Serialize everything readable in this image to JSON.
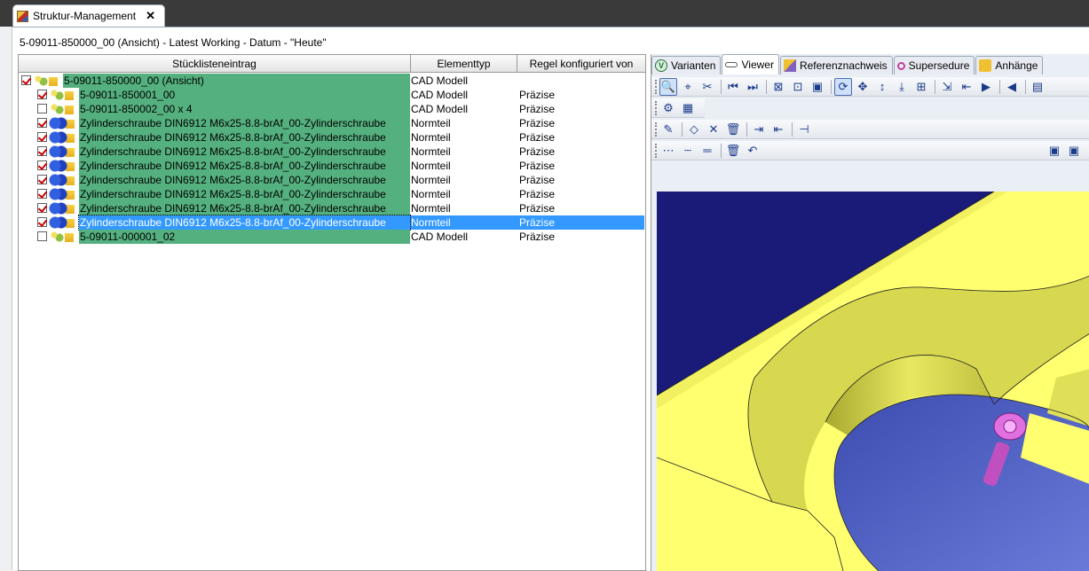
{
  "window": {
    "tab_title": "Struktur-Management",
    "close": "✕"
  },
  "headline": "5-09011-850000_00 (Ansicht) - Latest Working - Datum - \"Heute\"",
  "table": {
    "columns": [
      "Stücklisteneintrag",
      "Elementtyp",
      "Regel konfiguriert von"
    ],
    "rows": [
      {
        "name": "5-09011-850000_00 (Ansicht)",
        "type": "CAD Modell",
        "rule": "",
        "checked": true,
        "icon": "cad-assembly-icon"
      },
      {
        "name": "5-09011-850001_00",
        "type": "CAD Modell",
        "rule": "Präzise",
        "checked": true,
        "icon": "cad-assembly-icon"
      },
      {
        "name": "5-09011-850002_00 x 4",
        "type": "CAD Modell",
        "rule": "Präzise",
        "checked": false,
        "icon": "cad-assembly-icon"
      },
      {
        "name": "Zylinderschraube DIN6912 M6x25-8.8-brAf_00-Zylinderschraube",
        "type": "Normteil",
        "rule": "Präzise",
        "checked": true,
        "icon": "standard-part-icon"
      },
      {
        "name": "Zylinderschraube DIN6912 M6x25-8.8-brAf_00-Zylinderschraube",
        "type": "Normteil",
        "rule": "Präzise",
        "checked": true,
        "icon": "standard-part-icon"
      },
      {
        "name": "Zylinderschraube DIN6912 M6x25-8.8-brAf_00-Zylinderschraube",
        "type": "Normteil",
        "rule": "Präzise",
        "checked": true,
        "icon": "standard-part-icon"
      },
      {
        "name": "Zylinderschraube DIN6912 M6x25-8.8-brAf_00-Zylinderschraube",
        "type": "Normteil",
        "rule": "Präzise",
        "checked": true,
        "icon": "standard-part-icon"
      },
      {
        "name": "Zylinderschraube DIN6912 M6x25-8.8-brAf_00-Zylinderschraube",
        "type": "Normteil",
        "rule": "Präzise",
        "checked": true,
        "icon": "standard-part-icon"
      },
      {
        "name": "Zylinderschraube DIN6912 M6x25-8.8-brAf_00-Zylinderschraube",
        "type": "Normteil",
        "rule": "Präzise",
        "checked": true,
        "icon": "standard-part-icon"
      },
      {
        "name": "Zylinderschraube DIN6912 M6x25-8.8-brAf_00-Zylinderschraube",
        "type": "Normteil",
        "rule": "Präzise",
        "checked": true,
        "icon": "standard-part-icon"
      },
      {
        "name": "Zylinderschraube DIN6912 M6x25-8.8-brAf_00-Zylinderschraube",
        "type": "Normteil",
        "rule": "Präzise",
        "checked": true,
        "icon": "standard-part-icon",
        "selected": true
      },
      {
        "name": "5-09011-000001_02",
        "type": "CAD Modell",
        "rule": "Präzise",
        "checked": false,
        "icon": "cad-assembly-icon"
      }
    ]
  },
  "viewer": {
    "tabs": [
      {
        "label": "Varianten",
        "icon": "variants-icon"
      },
      {
        "label": "Viewer",
        "icon": "glasses-icon",
        "active": true
      },
      {
        "label": "Referenznachweis",
        "icon": "reference-icon"
      },
      {
        "label": "Supersedure",
        "icon": "supersedure-icon"
      },
      {
        "label": "Anhänge",
        "icon": "attachments-icon"
      }
    ],
    "toolbar_row1": [
      "🔍",
      "⌖",
      "✂",
      "⏮",
      "⏭",
      "⊠",
      "⊡",
      "▣",
      "⟳",
      "✥",
      "↕",
      "⤓",
      "⊞",
      "⇲",
      "⇤",
      "▶",
      "◀",
      "▤"
    ],
    "toolbar_row2": [
      "⚙",
      "▦"
    ],
    "toolbar_row3": [
      "✎",
      "◇",
      "✕",
      "🗑",
      "⇥",
      "⇤",
      "⊣"
    ],
    "toolbar_row4": [
      "⋯",
      "┄",
      "═",
      "🗑",
      "↶"
    ],
    "toolbar_row4_right": [
      "▣",
      "▣"
    ],
    "colors": {
      "part": "#ffff66",
      "background": "#1a1a80",
      "screw": "#e070e0"
    }
  }
}
